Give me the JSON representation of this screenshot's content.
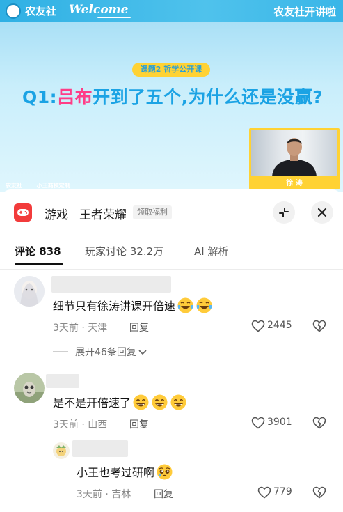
{
  "video": {
    "brand_logo_text": "农友社",
    "welcome_text": "Welcome",
    "show_name": "农友社开讲啦",
    "lesson_tag": "课题2 哲学公开课",
    "question_prefix": "Q1:",
    "question_highlight": "吕布",
    "question_rest": "开到了五个,为什么还是没赢?",
    "speaker_name": "徐 涛",
    "footer_logo_1": "农友社",
    "footer_logo_2": "小王商校定制"
  },
  "topic": {
    "category": "游戏",
    "name": "王者荣耀",
    "reward_label": "领取福利"
  },
  "tabs": [
    {
      "label": "评论 838"
    },
    {
      "label": "玩家讨论 32.2万"
    },
    {
      "label": "AI 解析"
    }
  ],
  "comments": [
    {
      "text": "细节只有徐涛讲课开倍速",
      "emojis": [
        "crying-laugh",
        "crying-laugh"
      ],
      "meta": "3天前 · 天津",
      "reply_label": "回复",
      "likes": "2445"
    },
    {
      "text": "是不是开倍速了",
      "emojis": [
        "grin",
        "grin",
        "grin"
      ],
      "meta": "3天前 · 山西",
      "reply_label": "回复",
      "likes": "3901"
    },
    {
      "text": "小王也考过研啊",
      "emojis": [
        "pleading"
      ],
      "meta": "3天前 · 吉林",
      "reply_label": "回复",
      "likes": "779"
    }
  ],
  "expand_replies": "展开46条回复",
  "colors": {
    "accent_blue": "#1ba3e4",
    "highlight_pink": "#ff3d87",
    "tag_yellow": "#ffd234",
    "app_red": "#f23b3b"
  }
}
